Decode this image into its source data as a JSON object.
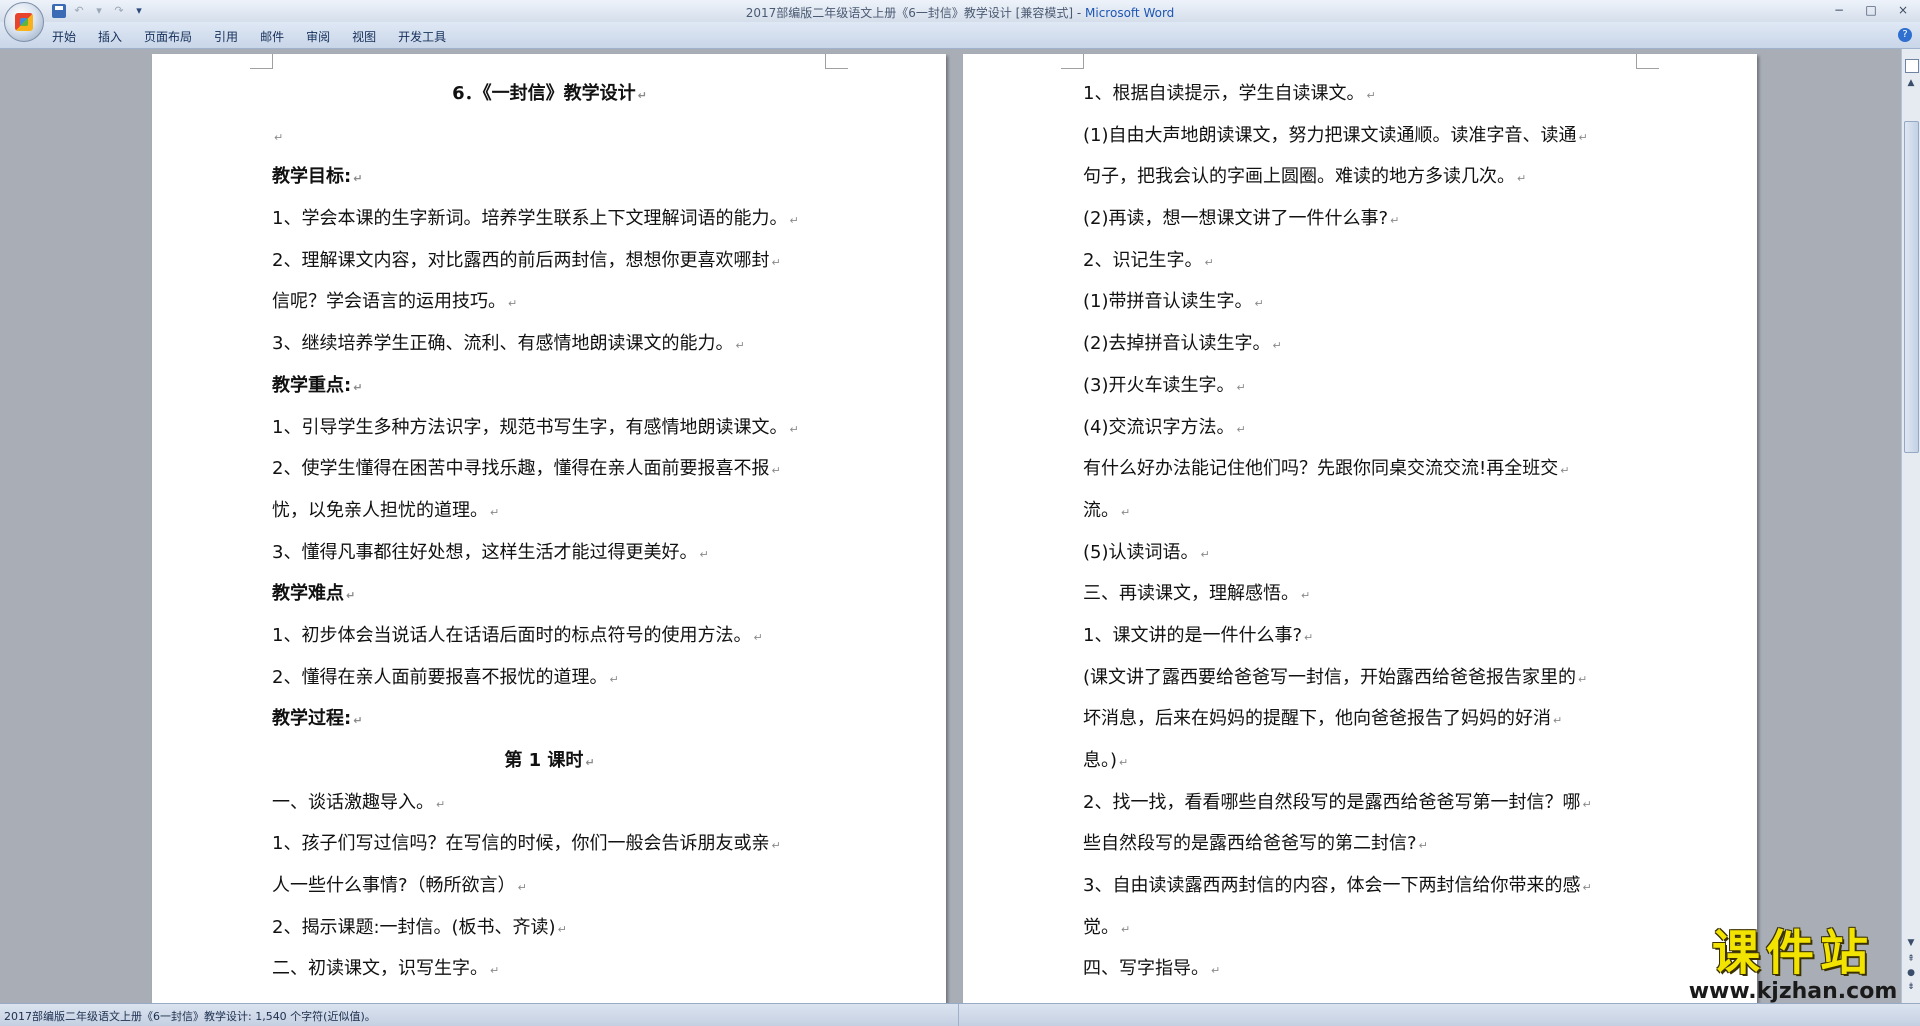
{
  "window": {
    "title_doc": "2017部编版二年级语文上册《6一封信》教学设计 [兼容模式]",
    "title_sep": " - ",
    "title_app": "Microsoft Word",
    "controls": [
      "−",
      "□",
      "×"
    ]
  },
  "quick_access": {
    "undo_label": "↶",
    "undo_dropdown": "▾",
    "redo_label": "↷",
    "customize_label": "▾"
  },
  "ribbon": {
    "tabs": [
      "开始",
      "插入",
      "页面布局",
      "引用",
      "邮件",
      "审阅",
      "视图",
      "开发工具"
    ],
    "help_label": "?"
  },
  "para_mark": "↵",
  "page_left": {
    "lines": [
      "6．《一封信》教学设计",
      "",
      "教学目标:",
      "1、学会本课的生字新词。培养学生联系上下文理解词语的能力。",
      "2、理解课文内容，对比露西的前后两封信，想想你更喜欢哪封",
      "信呢？学会语言的运用技巧。",
      "3、继续培养学生正确、流利、有感情地朗读课文的能力。",
      "教学重点:",
      "1、引导学生多种方法识字，规范书写生字，有感情地朗读课文。",
      "2、使学生懂得在困苦中寻找乐趣，懂得在亲人面前要报喜不报",
      "忧，以免亲人担忧的道理。",
      "3、懂得凡事都往好处想，这样生活才能过得更美好。",
      "教学难点",
      "1、初步体会当说话人在话语后面时的标点符号的使用方法。",
      "2、懂得在亲人面前要报喜不报忧的道理。",
      "教学过程:",
      "第 1 课时",
      "一、谈话激趣导入。",
      "1、孩子们写过信吗？在写信的时候，你们一般会告诉朋友或亲",
      "人一些什么事情?（畅所欲言）",
      "2、揭示课题:一封信。(板书、齐读)",
      "二、初读课文，识写生字。"
    ]
  },
  "page_right": {
    "lines": [
      "1、根据自读提示，学生自读课文。",
      "(1)自由大声地朗读课文，努力把课文读通顺。读准字音、读通",
      "句子，把我会认的字画上圆圈。难读的地方多读几次。",
      "(2)再读，想一想课文讲了一件什么事?",
      "2、识记生字。",
      "(1)带拼音认读生字。",
      " (2)去掉拼音认读生字。",
      " (3)开火车读生字。",
      "(4)交流识字方法。",
      "有什么好办法能记住他们吗？先跟你同桌交流交流!再全班交",
      "流。",
      "(5)认读词语。",
      "三、再读课文，理解感悟。",
      "1、课文讲的是一件什么事?",
      "(课文讲了露西要给爸爸写一封信，开始露西给爸爸报告家里的",
      "坏消息，后来在妈妈的提醒下，他向爸爸报告了妈妈的好消",
      "息。)",
      "2、找一找，看看哪些自然段写的是露西给爸爸写第一封信？哪",
      "些自然段写的是露西给爸爸写的第二封信?",
      "3、自由读读露西两封信的内容，体会一下两封信给你带来的感",
      "觉。",
      "四、写字指导。"
    ]
  },
  "statusbar": {
    "text": "2017部编版二年级语文上册《6一封信》教学设计: 1,540 个字符(近似值)。"
  },
  "watermark": {
    "cn": "课件站",
    "url": "www.kjzhan.com"
  },
  "colors": {
    "title_app": "#1e56b4",
    "workspace": "#a9aeb6",
    "watermark_yellow": "#f2e400"
  }
}
